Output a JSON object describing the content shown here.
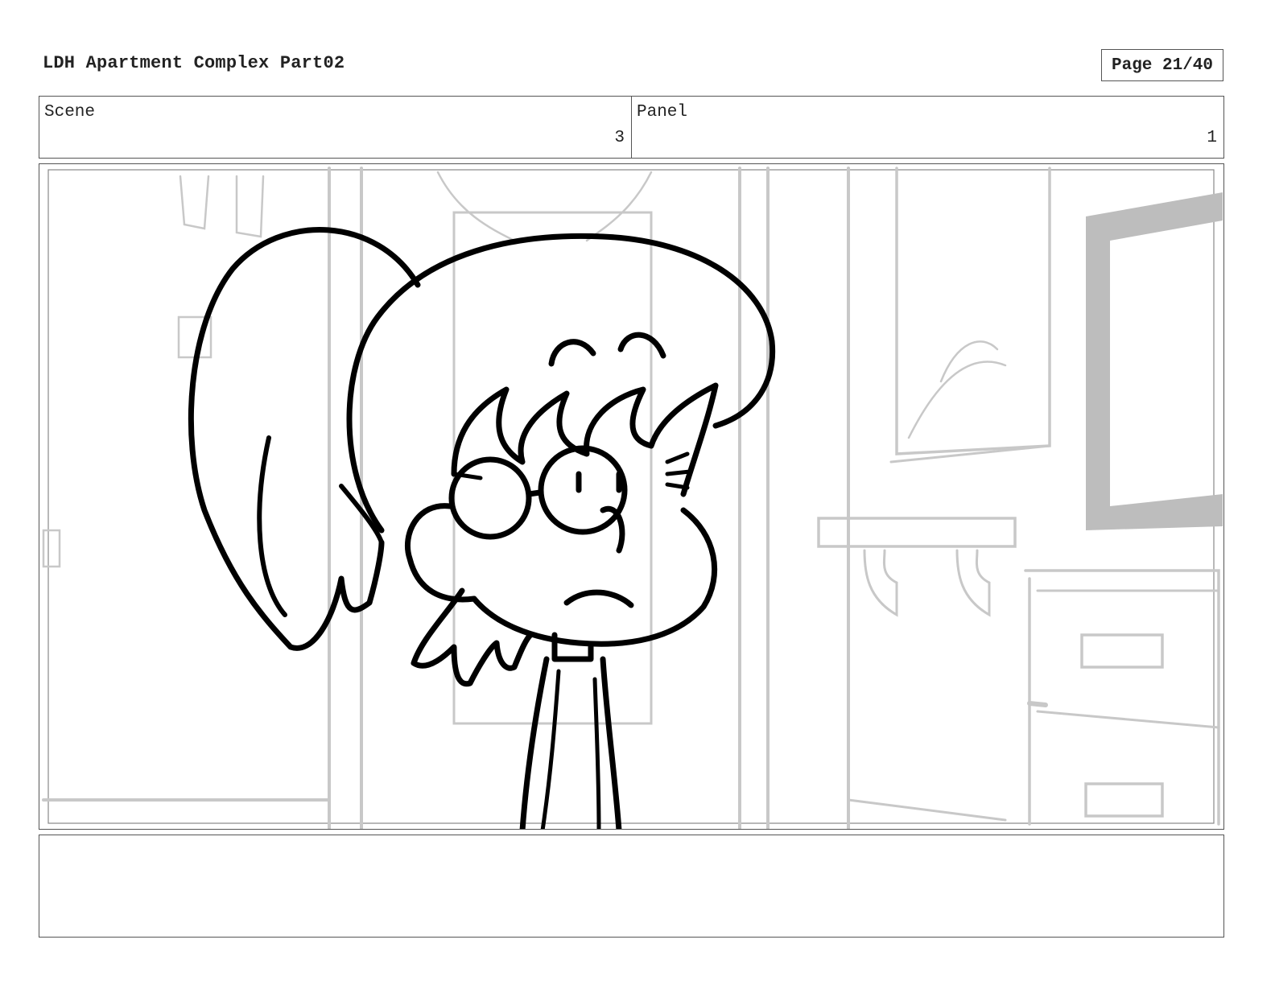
{
  "header": {
    "title": "LDH Apartment Complex Part02",
    "page_label": "Page 21/40"
  },
  "info": {
    "scene_label": "Scene",
    "scene_value": "3",
    "panel_label": "Panel",
    "panel_value": "1"
  },
  "notes": {
    "text": ""
  }
}
